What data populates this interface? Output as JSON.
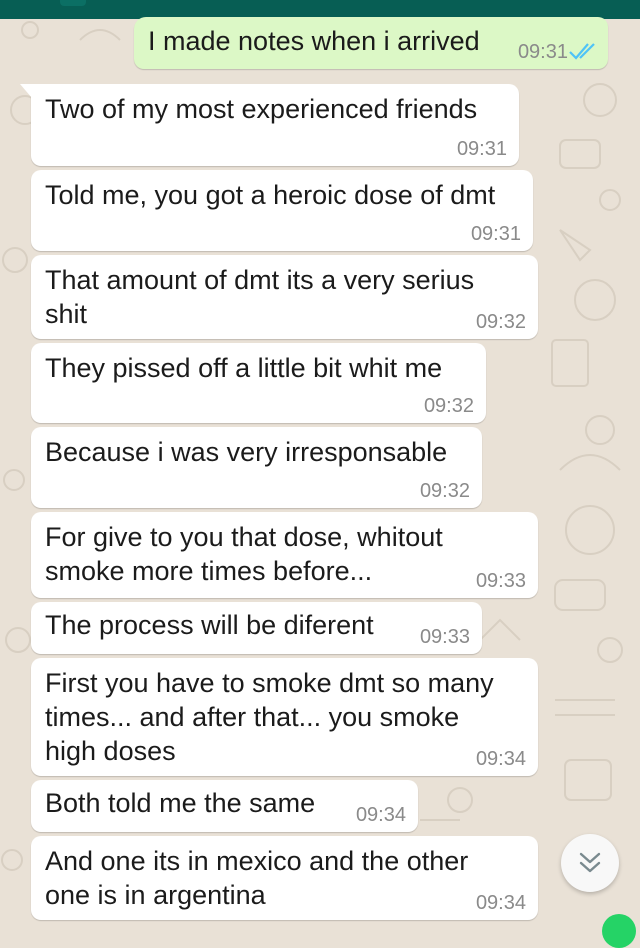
{
  "colors": {
    "chat_background": "#e9e1d6",
    "incoming_bubble": "#ffffff",
    "outgoing_bubble": "#dcf8c6",
    "header": "#075e54",
    "read_ticks": "#4fc3f7",
    "timestamp": "#8a8a8a"
  },
  "outgoing": {
    "text": "I made notes when i arrived",
    "time": "09:31",
    "status_icon": "double-check-read-icon"
  },
  "messages": [
    {
      "text": "Two of my most experienced friends",
      "time": "09:31"
    },
    {
      "text": "Told me, you got a heroic dose of dmt",
      "time": "09:31"
    },
    {
      "text": "That amount of dmt its a very serius\nshit",
      "time": "09:32"
    },
    {
      "text": "They pissed off a little bit whit me",
      "time": "09:32"
    },
    {
      "text": "Because i was very irresponsable",
      "time": "09:32"
    },
    {
      "text": "For give to you that dose, whitout\nsmoke more times before...",
      "time": "09:33"
    },
    {
      "text": "The process will be diferent",
      "time": "09:33"
    },
    {
      "text": "First you have to smoke dmt so many\ntimes... and after that... you smoke\nhigh doses",
      "time": "09:34"
    },
    {
      "text": "Both told me the same",
      "time": "09:34"
    },
    {
      "text": "And one its in mexico and the other\none is in argentina",
      "time": "09:34"
    }
  ],
  "scroll_button_icon": "double-chevron-down-icon"
}
